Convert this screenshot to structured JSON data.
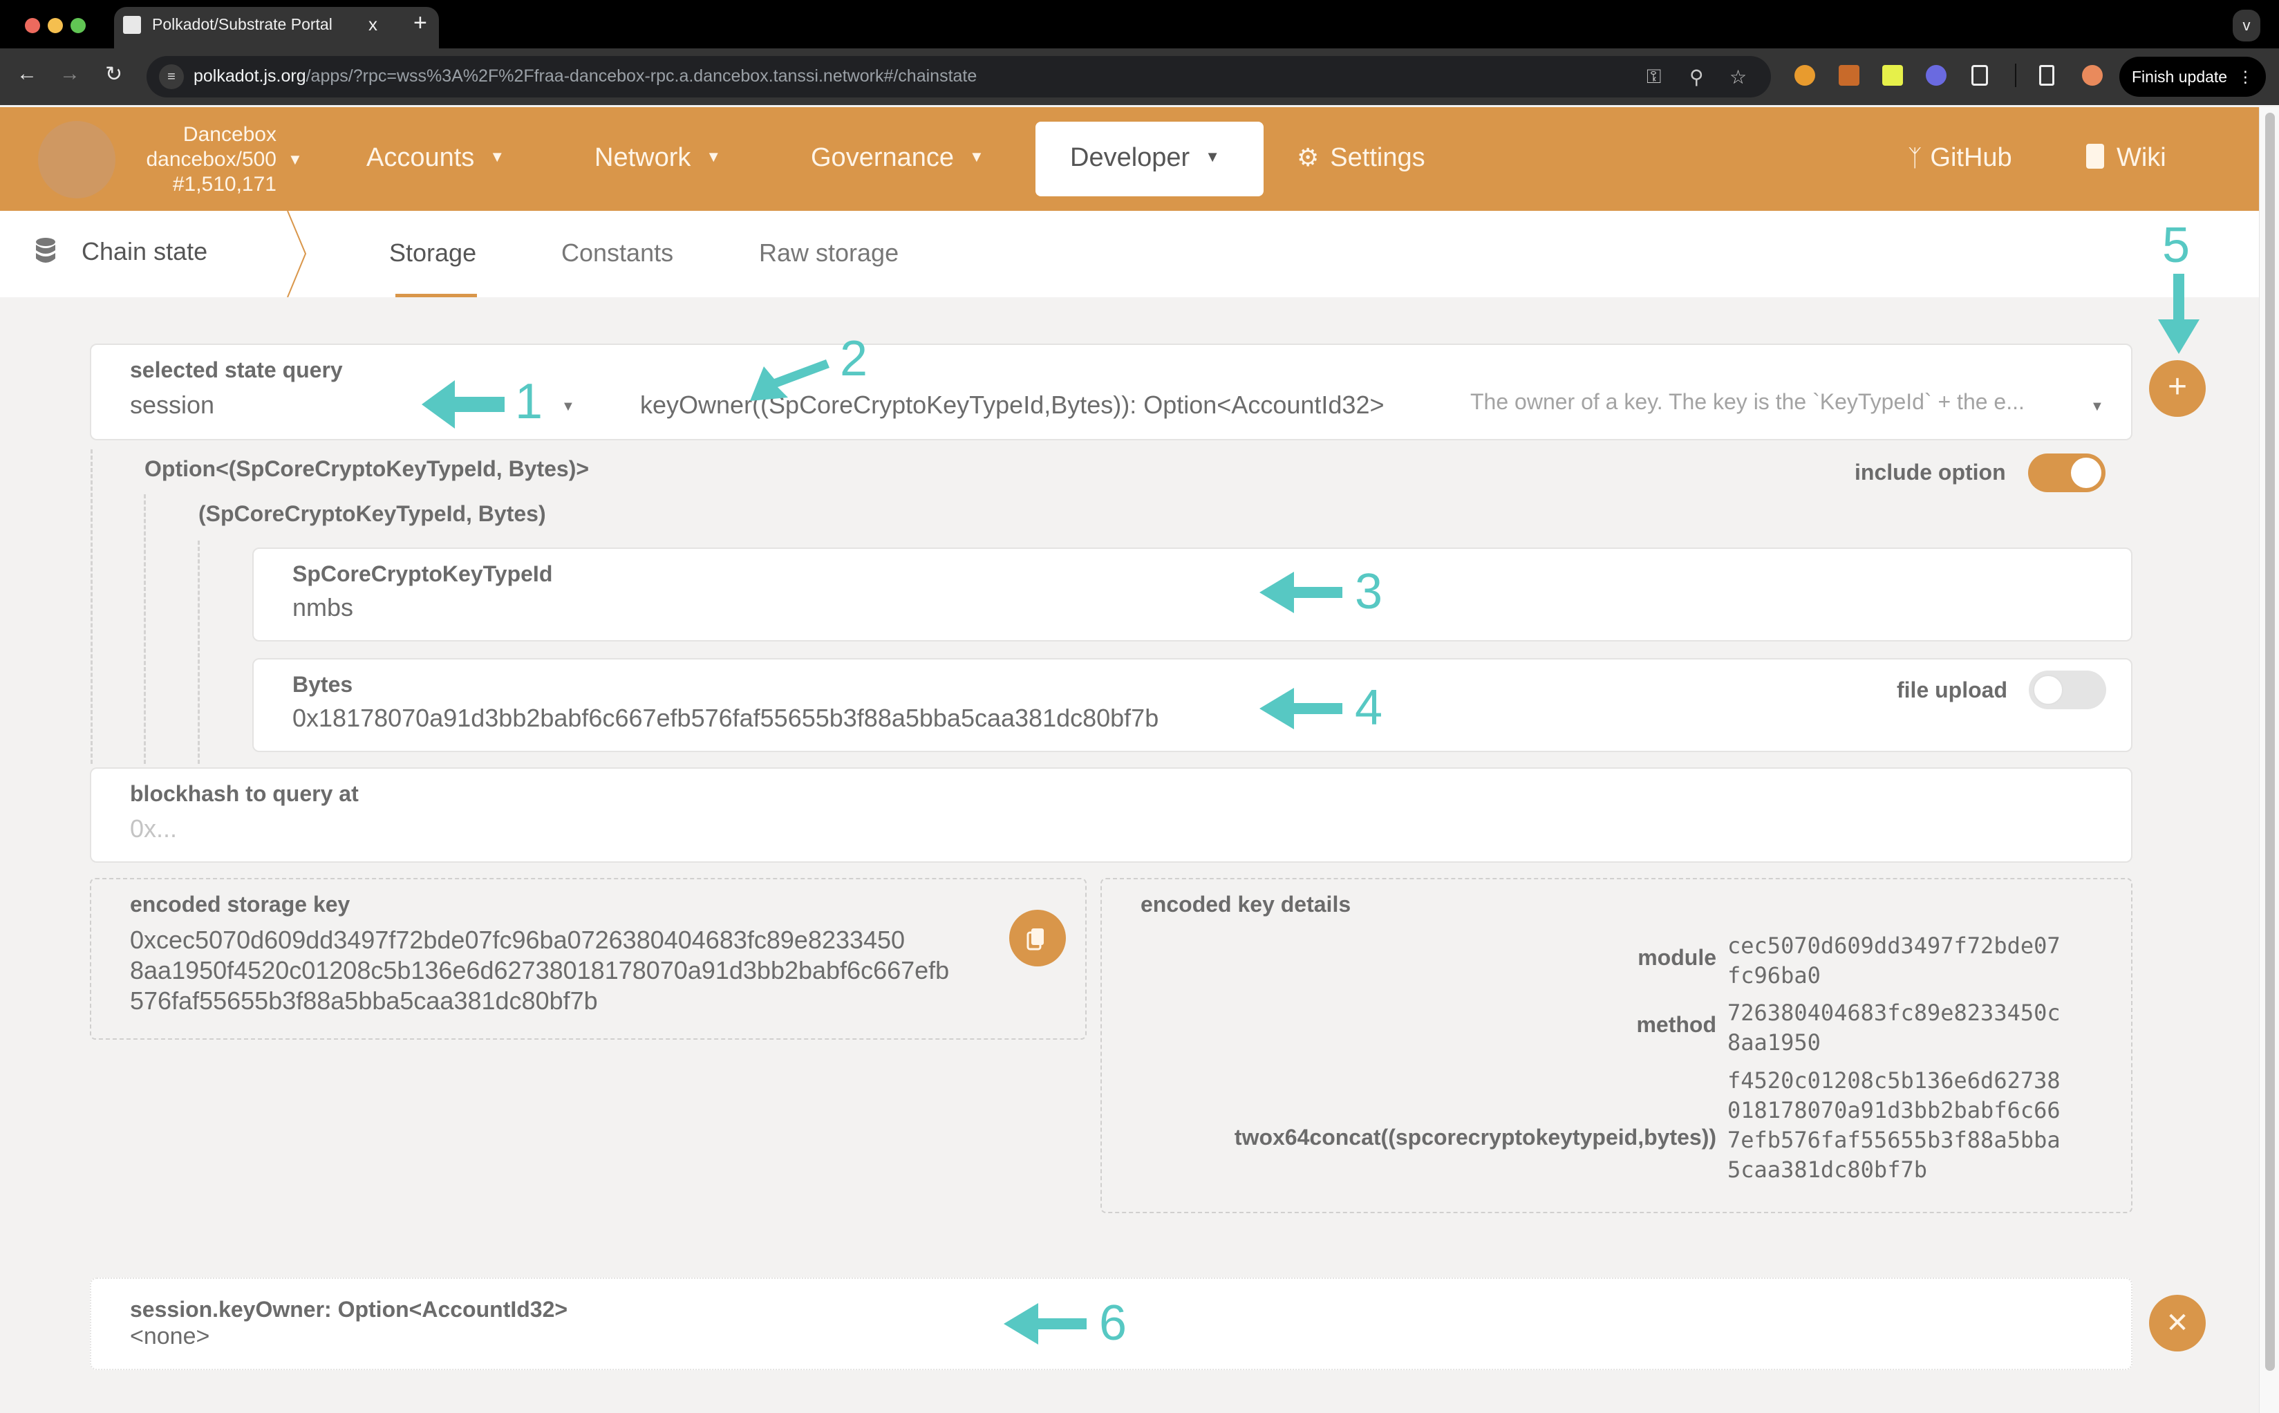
{
  "browser": {
    "tab_title": "Polkadot/Substrate Portal",
    "tab_close": "x",
    "new_tab": "+",
    "tab_menu": "v",
    "url_host": "polkadot.js.org",
    "url_path": "/apps/?rpc=wss%3A%2F%2Ffraa-dancebox-rpc.a.dancebox.tanssi.network#/chainstate",
    "finish_update_label": "Finish update",
    "icons": [
      "back-icon",
      "forward-icon",
      "reload-icon",
      "site-settings-icon",
      "password-key-icon",
      "zoom-icon",
      "bookmark-star-icon",
      "polkadot-extension-icon",
      "metamask-icon",
      "extension-hand-icon",
      "extension-bird-icon",
      "extensions-puzzle-icon",
      "side-panel-icon",
      "profile-avatar-icon",
      "more-menu-icon"
    ]
  },
  "appnav": {
    "chain_name": "Dancebox",
    "chain_spec": "dancebox/500",
    "block_number": "#1,510,171",
    "menus": [
      {
        "label": "Accounts"
      },
      {
        "label": "Network"
      },
      {
        "label": "Governance"
      },
      {
        "label": "Developer",
        "active": true
      }
    ],
    "settings_label": "Settings",
    "github_label": "GitHub",
    "wiki_label": "Wiki",
    "accent_color": "#d9964a"
  },
  "subnav": {
    "section_label": "Chain state",
    "tabs": [
      {
        "label": "Storage",
        "active": true
      },
      {
        "label": "Constants"
      },
      {
        "label": "Raw storage"
      }
    ]
  },
  "query": {
    "label": "selected state query",
    "module": "session",
    "method": "keyOwner((SpCoreCryptoKeyTypeId,Bytes)): Option<AccountId32>",
    "description": "The owner of a key. The key is the `KeyTypeId` + the e..."
  },
  "params": {
    "option_type": "Option<(SpCoreCryptoKeyTypeId, Bytes)>",
    "include_option_label": "include option",
    "include_option_on": true,
    "tuple_type": "(SpCoreCryptoKeyTypeId, Bytes)",
    "key_type_label": "SpCoreCryptoKeyTypeId",
    "key_type_value": "nmbs",
    "bytes_label": "Bytes",
    "bytes_value": "0x18178070a91d3bb2babf6c667efb576faf55655b3f88a5bba5caa381dc80bf7b",
    "file_upload_label": "file upload",
    "file_upload_on": false
  },
  "blockhash": {
    "label": "blockhash to query at",
    "placeholder": "0x..."
  },
  "encoded": {
    "label": "encoded storage key",
    "lines": [
      "0xcec5070d609dd3497f72bde07fc96ba0726380404683fc89e8233450",
      "8aa1950f4520c01208c5b136e6d62738018178070a91d3bb2babf6c667efb",
      "576faf55655b3f88a5bba5caa381dc80bf7b"
    ],
    "details_label": "encoded key details",
    "details": [
      {
        "name": "module",
        "lines": [
          "cec5070d609dd3497f72bde07",
          "fc96ba0"
        ]
      },
      {
        "name": "method",
        "lines": [
          "726380404683fc89e8233450c",
          "8aa1950"
        ]
      },
      {
        "name": "twox64concat((spcorecryptokeytypeid,bytes))",
        "lines": [
          "f4520c01208c5b136e6d62738",
          "018178070a91d3bb2babf6c66",
          "7efb576faf55655b3f88a5bba",
          "5caa381dc80bf7b"
        ]
      }
    ]
  },
  "result": {
    "title": "session.keyOwner: Option<AccountId32>",
    "value": "<none>"
  },
  "annotations": [
    "1",
    "2",
    "3",
    "4",
    "5",
    "6"
  ]
}
